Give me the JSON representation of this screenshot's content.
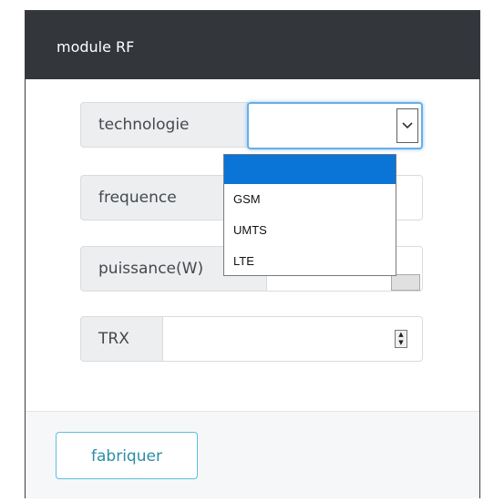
{
  "dialog": {
    "title": "module RF"
  },
  "form": {
    "technologie": {
      "label": "technologie",
      "value": "",
      "options": [
        "",
        "GSM",
        "UMTS",
        "LTE"
      ],
      "dropdown_open": true
    },
    "frequence": {
      "label": "frequence",
      "value": ""
    },
    "puissance": {
      "label": "puissance(W)",
      "value": ""
    },
    "trx": {
      "label": "TRX",
      "value": ""
    }
  },
  "footer": {
    "build_label": "fabriquer"
  },
  "colors": {
    "header_bg": "#33363b",
    "focus_border": "#66afe9",
    "selected_option": "#0a74d7",
    "button_border": "#5bc0de"
  },
  "icons": {
    "select_arrow": "chevron-down-icon",
    "spinner": "spinner-arrows-icon"
  }
}
